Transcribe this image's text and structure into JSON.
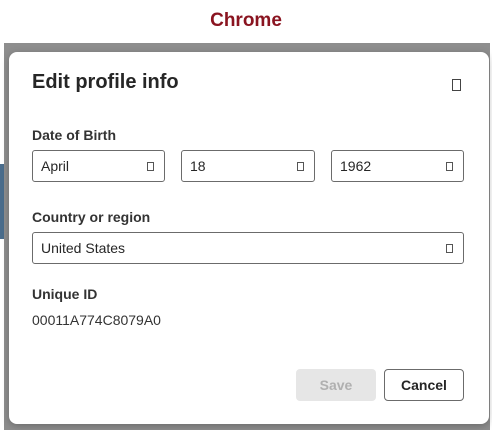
{
  "caption": "Chrome",
  "dialog": {
    "title": "Edit profile info",
    "close_icon": "close-icon",
    "dob": {
      "label": "Date of Birth",
      "month": "April",
      "day": "18",
      "year": "1962"
    },
    "country": {
      "label": "Country or region",
      "value": "United States"
    },
    "unique_id": {
      "label": "Unique ID",
      "value": "00011A774C8079A0"
    },
    "buttons": {
      "save": "Save",
      "cancel": "Cancel"
    }
  },
  "colors": {
    "caption": "#8a1420",
    "backdrop": "#8e8e8e",
    "disabled_button": "#e6e6e6"
  }
}
